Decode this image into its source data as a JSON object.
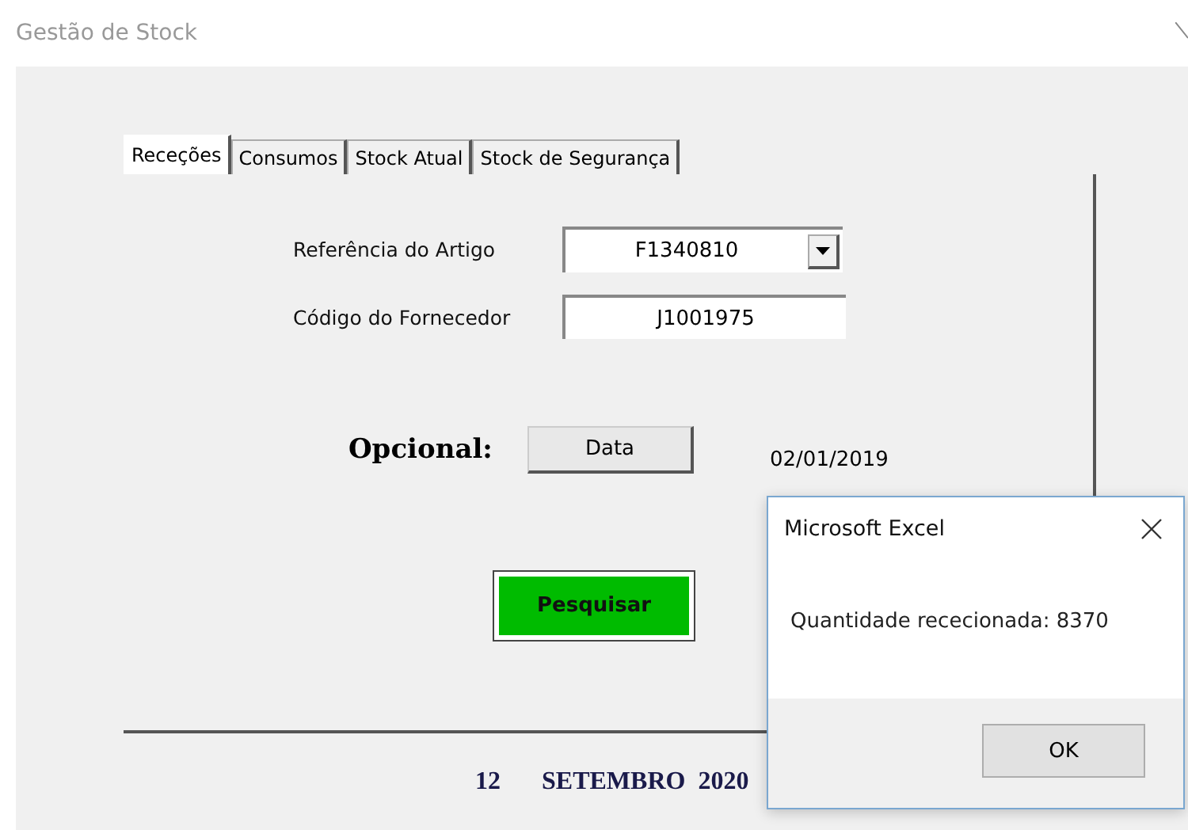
{
  "window": {
    "title": "Gestão de Stock"
  },
  "tabs": [
    {
      "label": "Receções",
      "selected": true
    },
    {
      "label": "Consumos",
      "selected": false
    },
    {
      "label": "Stock Atual",
      "selected": false
    },
    {
      "label": "Stock de Segurança",
      "selected": false
    }
  ],
  "form": {
    "article_label": "Referência do Artigo",
    "article_value": "F1340810",
    "supplier_label": "Código do Fornecedor",
    "supplier_value": "J1001975",
    "optional_label": "Opcional:",
    "date_button": "Data",
    "date_value": "02/01/2019",
    "search_button": "Pesquisar"
  },
  "footer": {
    "day": "12",
    "month_year": "SETEMBRO  2020"
  },
  "dialog": {
    "title": "Microsoft Excel",
    "message": "Quantidade rececionada: 8370",
    "button": "OK"
  }
}
